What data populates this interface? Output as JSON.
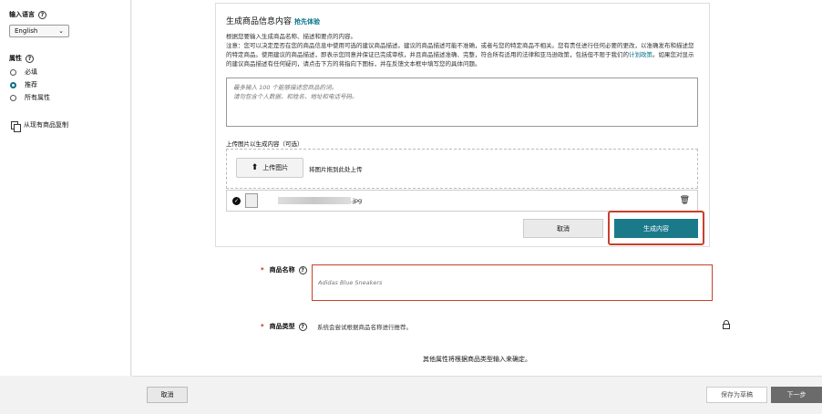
{
  "sidebar": {
    "input_language_label": "输入语言",
    "language_value": "English",
    "attributes_label": "属性",
    "radio_options": [
      {
        "label": "必填",
        "selected": false
      },
      {
        "label": "推荐",
        "selected": true
      },
      {
        "label": "所有属性",
        "selected": false
      }
    ],
    "copy_label": "从现有商品复制"
  },
  "generator": {
    "title": "生成商品信息内容",
    "trial_badge": "抢先体验",
    "intro": "根据您要输入生成商品名称、描述和要点的内容。",
    "notice": "注意：您可以决定是否在您的商品信息中使用可选的建议商品描述。建议的商品描述可能不准确，或者与您的特定商品不相关。您有责任进行任何必要的更改，以准确发布和描述您的特定商品。使用建议的商品描述，即表示您同意并保证已完成审核，并且商品描述准确、完整，符合所有适用的法律和亚马逊政策，包括但不限于我们的",
    "notice_link": "计划政策",
    "notice_tail": "。如果您对显示的建议商品描述有任何疑问，请点击下方的将指向下图标，并在反馈文本框中填写您的具体问题。",
    "description_placeholder": "最多输入 100 个能够描述您商品的词。\n请勿包含个人数据、和姓名、地址和电话号码。",
    "upload_label": "上传图片以生成内容（可选）",
    "upload_button": "上传图片",
    "drop_hint": "将图片拖到此处上传",
    "file_ext": ".jpg",
    "cancel_button": "取消",
    "generate_button": "生成内容"
  },
  "form": {
    "name_label": "商品名称",
    "name_placeholder": "Adidas Blue Sneakers",
    "type_label": "商品类型",
    "type_hint": "系统会尝试根据商品名称进行推荐。",
    "other_attributes": "其他属性将根据商品类型输入来确定。"
  },
  "footer": {
    "cancel": "取消",
    "save_draft": "保存为草稿",
    "next": "下一步"
  },
  "colors": {
    "accent": "#007185",
    "generate_bg": "#1b7a8a",
    "highlight": "#c7402a"
  }
}
